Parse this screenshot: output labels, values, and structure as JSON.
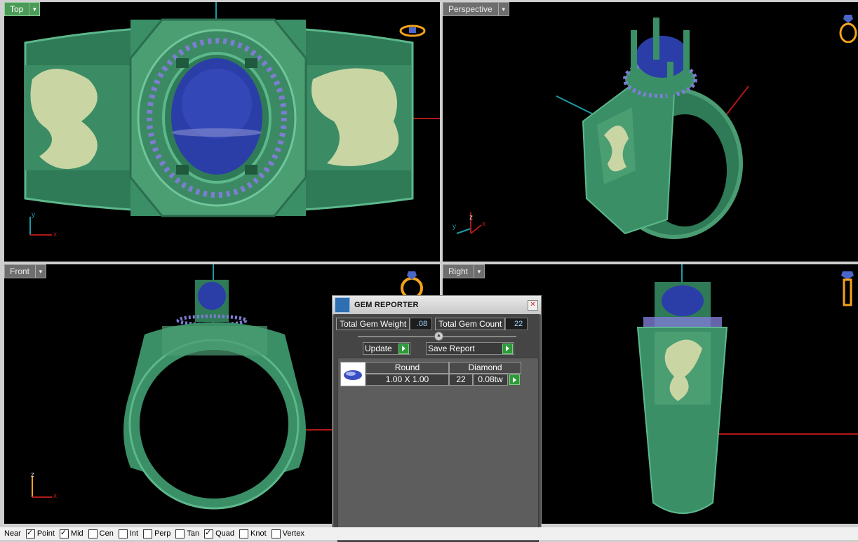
{
  "viewports": [
    {
      "id": "top",
      "label": "Top",
      "active": true,
      "axes": [
        "y",
        "x"
      ]
    },
    {
      "id": "perspective",
      "label": "Perspective",
      "active": false,
      "axes": [
        "z",
        "y",
        "x"
      ]
    },
    {
      "id": "front",
      "label": "Front",
      "active": false,
      "axes": [
        "z",
        "x"
      ]
    },
    {
      "id": "right",
      "label": "Right",
      "active": false,
      "axes": []
    }
  ],
  "gem_reporter": {
    "title": "GEM REPORTER",
    "total_weight_label": "Total Gem Weight",
    "total_weight_value": ".08",
    "total_count_label": "Total Gem Count",
    "total_count_value": "22",
    "update_label": "Update",
    "save_label": "Save Report",
    "gem_list": [
      {
        "shape": "Round",
        "material": "Diamond",
        "size": "1.00 X 1.00",
        "count": "22",
        "weight": "0.08tw"
      }
    ]
  },
  "osnap": [
    {
      "label": "Near",
      "checked": false
    },
    {
      "label": "Point",
      "checked": true
    },
    {
      "label": "Mid",
      "checked": true
    },
    {
      "label": "Cen",
      "checked": false
    },
    {
      "label": "Int",
      "checked": false
    },
    {
      "label": "Perp",
      "checked": false
    },
    {
      "label": "Tan",
      "checked": false
    },
    {
      "label": "Quad",
      "checked": true
    },
    {
      "label": "Knot",
      "checked": false
    },
    {
      "label": "Vertex",
      "checked": false
    }
  ],
  "colors": {
    "ring_green": "#3a8f67",
    "gem_blue": "#2b3ea8",
    "gold_relief": "#c9d6a4",
    "axis_red": "#b01818",
    "axis_cyan": "#1c9aa6"
  }
}
